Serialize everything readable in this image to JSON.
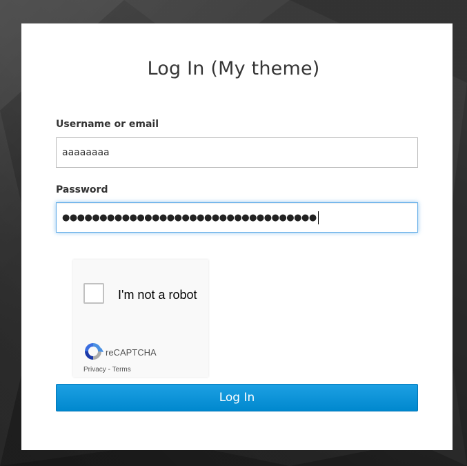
{
  "page": {
    "title": "Log In (My theme)"
  },
  "form": {
    "username_label": "Username or email",
    "username_value": "aaaaaaaa",
    "password_label": "Password",
    "password_mask": "●●●●●●●●●●●●●●●●●●●●●●●●●●●●●●●●●●"
  },
  "captcha": {
    "checkbox_label": "I'm not a robot",
    "brand": "reCAPTCHA",
    "privacy": "Privacy",
    "separator": " - ",
    "terms": "Terms",
    "icon": "recaptcha-logo-icon"
  },
  "actions": {
    "login_label": "Log In"
  },
  "colors": {
    "button": "#0088ce",
    "focus_border": "#66afe9",
    "background": "#303030"
  }
}
